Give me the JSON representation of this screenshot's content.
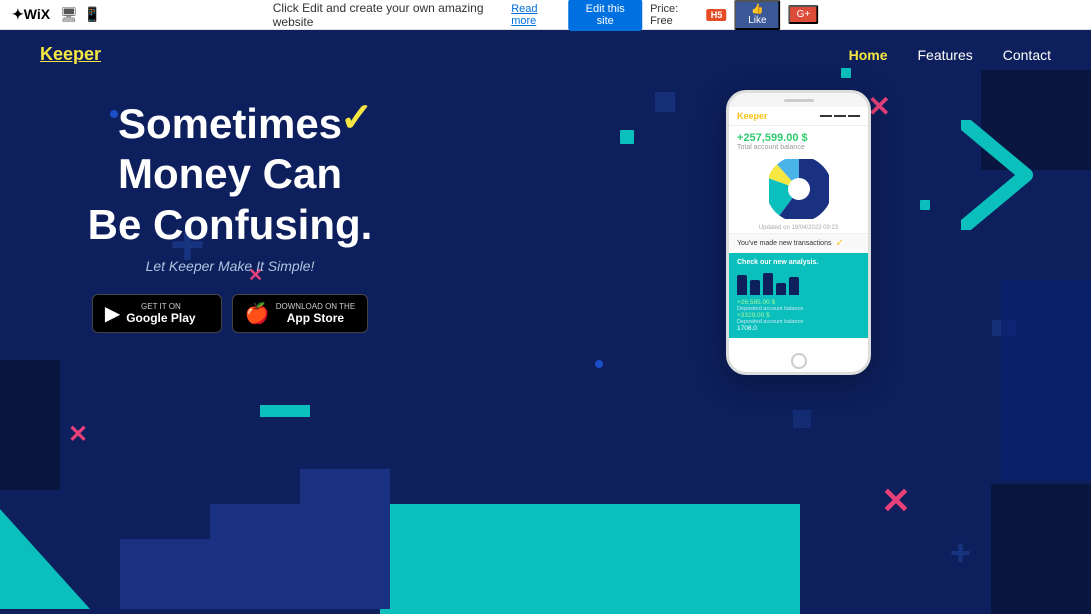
{
  "wixbar": {
    "logo": "WiX",
    "centerText": "Click Edit and create your own amazing website",
    "readMoreLabel": "Read more",
    "editBtnLabel": "Edit this site",
    "priceLabel": "Price: Free",
    "likeLabel": "Like",
    "gplusLabel": "G+"
  },
  "nav": {
    "logo": "Keeper",
    "links": [
      {
        "label": "Home",
        "active": true
      },
      {
        "label": "Features",
        "active": false
      },
      {
        "label": "Contact",
        "active": false
      }
    ]
  },
  "hero": {
    "title_line1": "Sometimes",
    "title_line2": "Money Can",
    "title_line3": "Be Confusing.",
    "subtitle": "Let Keeper Make It Simple!",
    "google_play_top": "GET IT ON",
    "google_play_bottom": "Google Play",
    "app_store_top": "Download on the",
    "app_store_bottom": "App Store"
  },
  "phone_app": {
    "app_name": "Keeper",
    "balance": "+257,599.00 $",
    "balance_label": "Total account balance",
    "updated": "Updated on 18/04/2023 09:23",
    "notification": "You've made new transactions",
    "analytics_title": "Check our new analysis.",
    "stat1": "+26,585.00 $",
    "stat1_label": "Deposited account balance",
    "stat2": "+3329.00 $",
    "stat2_label": "Deposited account balance",
    "stat3": "1708.0"
  },
  "shapes": {
    "checkmark": "✓",
    "x_mark": "✗",
    "plus_mark": "+",
    "chevron": "❯"
  },
  "colors": {
    "accent_yellow": "#f5e642",
    "accent_teal": "#0abfbc",
    "accent_pink": "#e8417a",
    "bg_dark": "#0d1f5c",
    "bg_darker": "#0a1540"
  }
}
